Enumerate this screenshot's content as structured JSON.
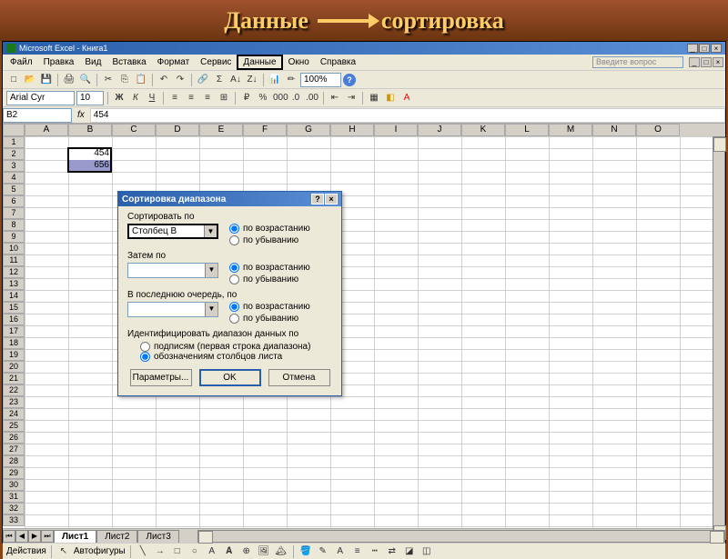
{
  "slide": {
    "left": "Данные",
    "right": "сортировка"
  },
  "title": "Microsoft Excel - Книга1",
  "ask_placeholder": "Введите вопрос",
  "menu": [
    "Файл",
    "Правка",
    "Вид",
    "Вставка",
    "Формат",
    "Сервис",
    "Данные",
    "Окно",
    "Справка"
  ],
  "menu_hl_index": 6,
  "zoom": "100%",
  "font": "Arial Cyr",
  "font_size": "10",
  "name_box": "B2",
  "formula": "454",
  "fx": "fx",
  "columns": [
    "A",
    "B",
    "C",
    "D",
    "E",
    "F",
    "G",
    "H",
    "I",
    "J",
    "K",
    "L",
    "M",
    "N",
    "O"
  ],
  "row_count": 33,
  "cells": {
    "b2": "454",
    "b3": "656"
  },
  "sheets": [
    "Лист1",
    "Лист2",
    "Лист3"
  ],
  "draw_label": "Действия",
  "autoshapes": "Автофигуры",
  "dialog": {
    "title": "Сортировка диапазона",
    "sort_by": "Сортировать по",
    "then_by": "Затем по",
    "then_by2": "В последнюю очередь, по",
    "col_b": "Столбец B",
    "asc": "по возрастанию",
    "desc": "по убыванию",
    "identify": "Идентифицировать диапазон данных по",
    "headers": "подписям (первая строка диапазона)",
    "no_headers": "обозначениям столбцов листа",
    "params": "Параметры...",
    "ok": "OK",
    "cancel": "Отмена"
  }
}
